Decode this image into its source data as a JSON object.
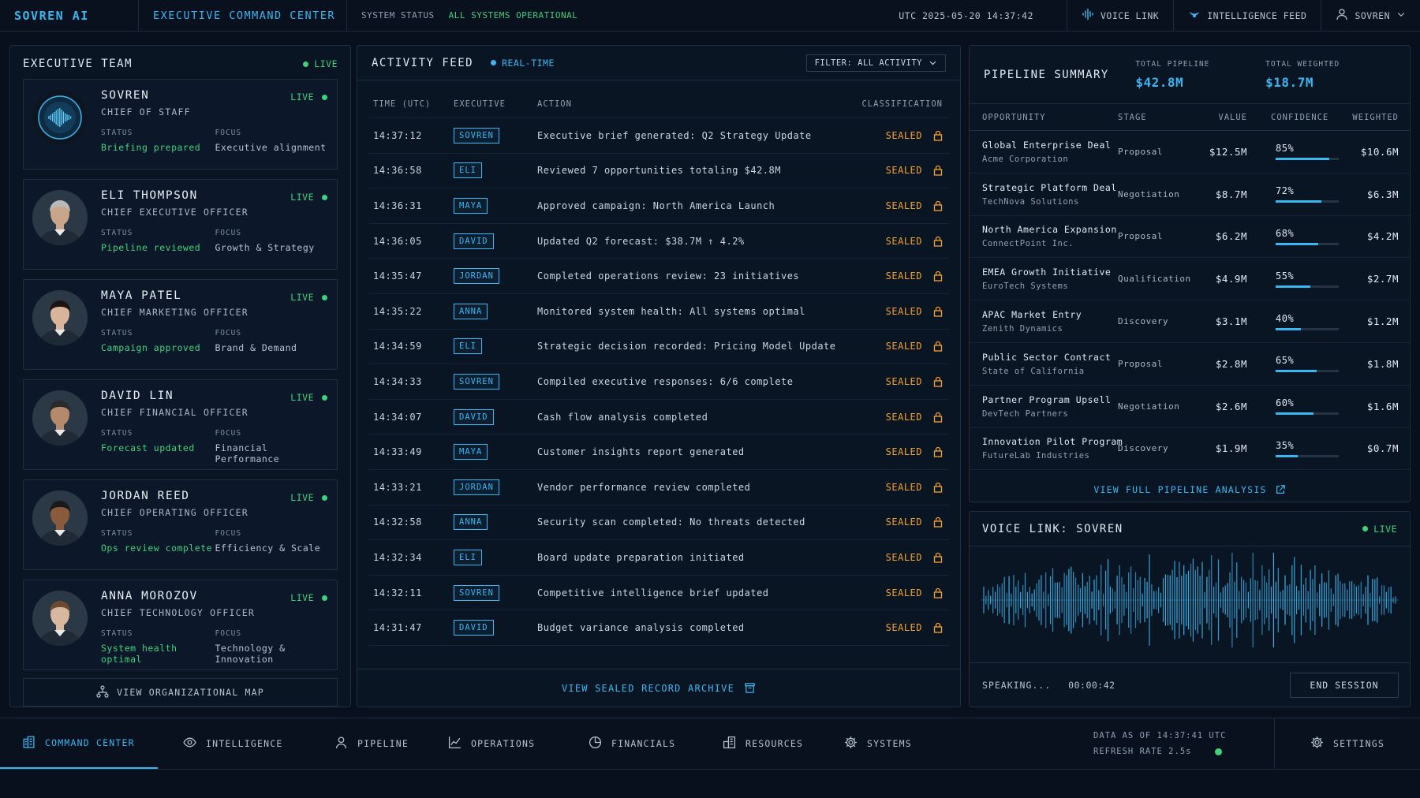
{
  "topbar": {
    "brand": "SOVREN AI",
    "title": "EXECUTIVE COMMAND CENTER",
    "status_label": "SYSTEM STATUS",
    "status_value": "ALL SYSTEMS OPERATIONAL",
    "timestamp": "UTC 2025-05-20 14:37:42",
    "voice_link": "VOICE LINK",
    "intel_feed": "INTELLIGENCE FEED",
    "user": "SOVREN"
  },
  "team": {
    "title": "EXECUTIVE TEAM",
    "live": "LIVE",
    "status_key": "STATUS",
    "focus_key": "FOCUS",
    "members": [
      {
        "name": "SOVREN",
        "role": "CHIEF OF STAFF",
        "live": "LIVE",
        "status": "Briefing prepared",
        "focus": "Executive alignment",
        "avatar": "ai-orb"
      },
      {
        "name": "ELI THOMPSON",
        "role": "CHIEF EXECUTIVE OFFICER",
        "live": "LIVE",
        "status": "Pipeline reviewed",
        "focus": "Growth & Strategy",
        "avatar": "person"
      },
      {
        "name": "MAYA PATEL",
        "role": "CHIEF MARKETING OFFICER",
        "live": "LIVE",
        "status": "Campaign approved",
        "focus": "Brand & Demand",
        "avatar": "person"
      },
      {
        "name": "DAVID LIN",
        "role": "CHIEF FINANCIAL OFFICER",
        "live": "LIVE",
        "status": "Forecast updated",
        "focus": "Financial Performance",
        "avatar": "person"
      },
      {
        "name": "JORDAN REED",
        "role": "CHIEF OPERATING OFFICER",
        "live": "LIVE",
        "status": "Ops review complete",
        "focus": "Efficiency & Scale",
        "avatar": "person"
      },
      {
        "name": "ANNA MOROZOV",
        "role": "CHIEF TECHNOLOGY OFFICER",
        "live": "LIVE",
        "status": "System health optimal",
        "focus": "Technology & Innovation",
        "avatar": "person"
      }
    ],
    "org_map": "VIEW ORGANIZATIONAL MAP"
  },
  "feed": {
    "title": "ACTIVITY FEED",
    "realtime": "REAL-TIME",
    "filter": "FILTER: ALL ACTIVITY",
    "columns": [
      "TIME (UTC)",
      "EXECUTIVE",
      "ACTION",
      "CLASSIFICATION"
    ],
    "rows": [
      {
        "time": "14:37:12",
        "exec": "SOVREN",
        "action": "Executive brief generated: Q2 Strategy Update",
        "cls": "SEALED"
      },
      {
        "time": "14:36:58",
        "exec": "ELI",
        "action": "Reviewed 7 opportunities totaling $42.8M",
        "cls": "SEALED"
      },
      {
        "time": "14:36:31",
        "exec": "MAYA",
        "action": "Approved campaign: North America Launch",
        "cls": "SEALED"
      },
      {
        "time": "14:36:05",
        "exec": "DAVID",
        "action": "Updated Q2 forecast: $38.7M ↑ 4.2%",
        "cls": "SEALED"
      },
      {
        "time": "14:35:47",
        "exec": "JORDAN",
        "action": "Completed operations review: 23 initiatives",
        "cls": "SEALED"
      },
      {
        "time": "14:35:22",
        "exec": "ANNA",
        "action": "Monitored system health: All systems optimal",
        "cls": "SEALED"
      },
      {
        "time": "14:34:59",
        "exec": "ELI",
        "action": "Strategic decision recorded: Pricing Model Update",
        "cls": "SEALED"
      },
      {
        "time": "14:34:33",
        "exec": "SOVREN",
        "action": "Compiled executive responses: 6/6 complete",
        "cls": "SEALED"
      },
      {
        "time": "14:34:07",
        "exec": "DAVID",
        "action": "Cash flow analysis completed",
        "cls": "SEALED"
      },
      {
        "time": "14:33:49",
        "exec": "MAYA",
        "action": "Customer insights report generated",
        "cls": "SEALED"
      },
      {
        "time": "14:33:21",
        "exec": "JORDAN",
        "action": "Vendor performance review completed",
        "cls": "SEALED"
      },
      {
        "time": "14:32:58",
        "exec": "ANNA",
        "action": "Security scan completed: No threats detected",
        "cls": "SEALED"
      },
      {
        "time": "14:32:34",
        "exec": "ELI",
        "action": "Board update preparation initiated",
        "cls": "SEALED"
      },
      {
        "time": "14:32:11",
        "exec": "SOVREN",
        "action": "Competitive intelligence brief updated",
        "cls": "SEALED"
      },
      {
        "time": "14:31:47",
        "exec": "DAVID",
        "action": "Budget variance analysis completed",
        "cls": "SEALED"
      }
    ],
    "archive": "VIEW SEALED RECORD ARCHIVE"
  },
  "pipeline": {
    "title": "PIPELINE SUMMARY",
    "total_label": "TOTAL PIPELINE",
    "total_value": "$42.8M",
    "weighted_label": "TOTAL WEIGHTED",
    "weighted_value": "$18.7M",
    "columns": [
      "OPPORTUNITY",
      "STAGE",
      "VALUE",
      "CONFIDENCE",
      "WEIGHTED"
    ],
    "rows": [
      {
        "name": "Global Enterprise Deal",
        "company": "Acme Corporation",
        "stage": "Proposal",
        "value": "$12.5M",
        "confidence": "85%",
        "conf": 0.85,
        "weighted": "$10.6M"
      },
      {
        "name": "Strategic Platform Deal",
        "company": "TechNova Solutions",
        "stage": "Negotiation",
        "value": "$8.7M",
        "confidence": "72%",
        "conf": 0.72,
        "weighted": "$6.3M"
      },
      {
        "name": "North America Expansion",
        "company": "ConnectPoint Inc.",
        "stage": "Proposal",
        "value": "$6.2M",
        "confidence": "68%",
        "conf": 0.68,
        "weighted": "$4.2M"
      },
      {
        "name": "EMEA Growth Initiative",
        "company": "EuroTech Systems",
        "stage": "Qualification",
        "value": "$4.9M",
        "confidence": "55%",
        "conf": 0.55,
        "weighted": "$2.7M"
      },
      {
        "name": "APAC Market Entry",
        "company": "Zenith Dynamics",
        "stage": "Discovery",
        "value": "$3.1M",
        "confidence": "40%",
        "conf": 0.4,
        "weighted": "$1.2M"
      },
      {
        "name": "Public Sector Contract",
        "company": "State of California",
        "stage": "Proposal",
        "value": "$2.8M",
        "confidence": "65%",
        "conf": 0.65,
        "weighted": "$1.8M"
      },
      {
        "name": "Partner Program Upsell",
        "company": "DevTech Partners",
        "stage": "Negotiation",
        "value": "$2.6M",
        "confidence": "60%",
        "conf": 0.6,
        "weighted": "$1.6M"
      },
      {
        "name": "Innovation Pilot Program",
        "company": "FutureLab Industries",
        "stage": "Discovery",
        "value": "$1.9M",
        "confidence": "35%",
        "conf": 0.35,
        "weighted": "$0.7M"
      }
    ],
    "full_analysis": "VIEW FULL PIPELINE ANALYSIS"
  },
  "voice": {
    "title": "VOICE LINK: SOVREN",
    "live": "LIVE",
    "speaking": "SPEAKING...",
    "timer": "00:00:42",
    "end": "END SESSION"
  },
  "nav": {
    "items": [
      {
        "label": "COMMAND CENTER",
        "icon": "building-icon",
        "active": true
      },
      {
        "label": "INTELLIGENCE",
        "icon": "eye-icon",
        "active": false
      },
      {
        "label": "PIPELINE",
        "icon": "person-icon",
        "active": false
      },
      {
        "label": "OPERATIONS",
        "icon": "chart-icon",
        "active": false
      },
      {
        "label": "FINANCIALS",
        "icon": "pie-icon",
        "active": false
      },
      {
        "label": "RESOURCES",
        "icon": "buildings-icon",
        "active": false
      },
      {
        "label": "SYSTEMS",
        "icon": "gear-icon",
        "active": false
      }
    ],
    "data_as_of": "DATA AS OF 14:37:41 UTC",
    "refresh": "REFRESH RATE 2.5s",
    "settings": "SETTINGS"
  },
  "colors": {
    "accent": "#3ab7f0",
    "live": "#3fd27c",
    "sealed": "#f3a22c",
    "background": "#07101c"
  }
}
